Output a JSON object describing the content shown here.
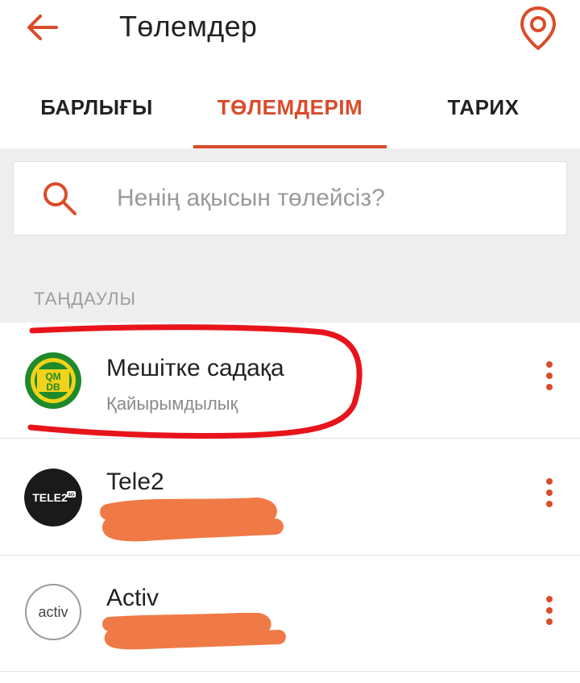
{
  "header": {
    "title": "Төлемдер",
    "back_icon": "arrow-left-icon",
    "location_icon": "map-pin-icon",
    "accent": "#d94c2a"
  },
  "tabs": [
    {
      "label": "БАРЛЫҒЫ",
      "active": false
    },
    {
      "label": "ТӨЛЕМДЕРІМ",
      "active": true
    },
    {
      "label": "ТАРИХ",
      "active": false
    }
  ],
  "search": {
    "placeholder": "Ненің ақысын төлейсіз?",
    "icon": "search-icon"
  },
  "favorites": {
    "label": "ТАҢДАУЛЫ",
    "items": [
      {
        "title": "Мешітке садақа",
        "subtitle": "Қайырымдылық",
        "logo_text": "QMDB",
        "logo": "qmdb-logo",
        "highlighted": true
      },
      {
        "title": "Tele2",
        "subtitle": "",
        "logo_text": "TELE2",
        "logo_badge": "4G",
        "logo": "tele2-logo",
        "subtitle_redacted": true
      },
      {
        "title": "Activ",
        "subtitle": "",
        "logo_text": "activ",
        "logo": "activ-logo",
        "subtitle_redacted": true
      }
    ]
  },
  "colors": {
    "accent": "#d94c2a",
    "annotation_red": "#e8141b",
    "redaction": "#f07a45"
  }
}
